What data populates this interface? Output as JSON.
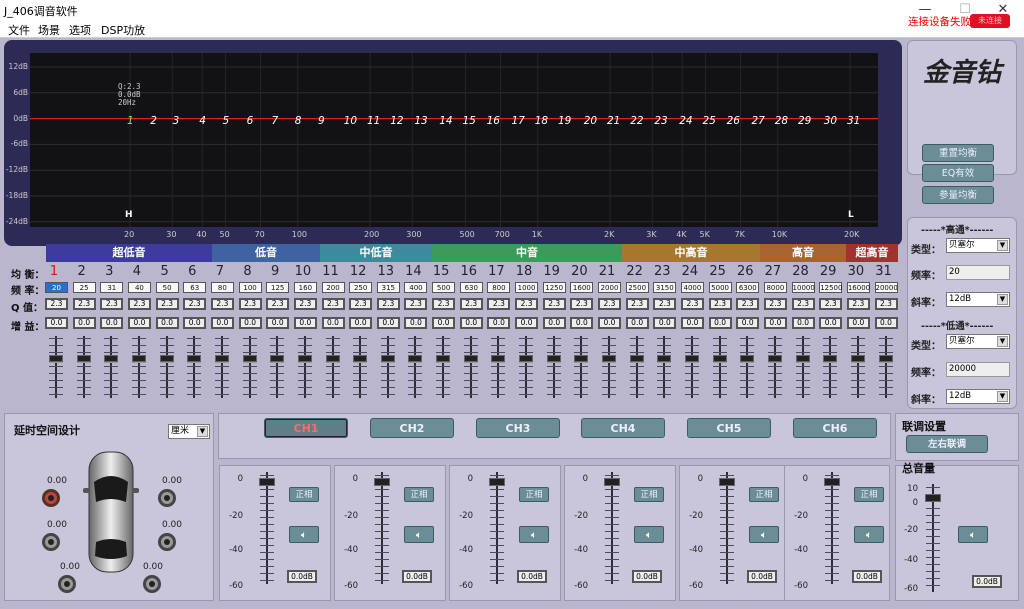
{
  "window": {
    "title": "J_406调音软件",
    "min": "—",
    "max": "☐",
    "close": "✕"
  },
  "menu": [
    "文件",
    "场景",
    "选项",
    "DSP功放"
  ],
  "graph": {
    "y_ticks": [
      "12dB",
      "6dB",
      "0dB",
      "-6dB",
      "-12dB",
      "-18dB",
      "-24dB"
    ],
    "x_ticks": [
      "20",
      "30",
      "40",
      "50",
      "70",
      "100",
      "200",
      "300",
      "500",
      "700",
      "1K",
      "2K",
      "3K",
      "4K",
      "5K",
      "7K",
      "10K",
      "20K"
    ],
    "tooltip": [
      "Q:2.3",
      "0.0dB",
      "20Hz"
    ],
    "marker_h": "H",
    "marker_l": "L",
    "points": [
      "1",
      "2",
      "3",
      "4",
      "5",
      "6",
      "7",
      "8",
      "9",
      "10",
      "11",
      "12",
      "13",
      "14",
      "15",
      "16",
      "17",
      "18",
      "19",
      "20",
      "21",
      "22",
      "23",
      "24",
      "25",
      "26",
      "27",
      "28",
      "29",
      "30",
      "31"
    ]
  },
  "bands": [
    {
      "label": "超低音",
      "color": "#3b3c9e"
    },
    {
      "label": "低音",
      "color": "#3f63a0"
    },
    {
      "label": "中低音",
      "color": "#3c8a9c"
    },
    {
      "label": "中音",
      "color": "#3b9b58"
    },
    {
      "label": "中高音",
      "color": "#a8772e"
    },
    {
      "label": "高音",
      "color": "#a8642e"
    },
    {
      "label": "超高音",
      "color": "#a53030"
    }
  ],
  "eq": {
    "row_labels": {
      "channel": "均 衡：",
      "freq": "频 率：",
      "q": "Q 值：",
      "gain": "增 益："
    },
    "channels": [
      "1",
      "2",
      "3",
      "4",
      "5",
      "6",
      "7",
      "8",
      "9",
      "10",
      "11",
      "12",
      "13",
      "14",
      "15",
      "16",
      "17",
      "18",
      "19",
      "20",
      "21",
      "22",
      "23",
      "24",
      "25",
      "26",
      "27",
      "28",
      "29",
      "30",
      "31"
    ],
    "freqs": [
      "20",
      "25",
      "31",
      "40",
      "50",
      "63",
      "80",
      "100",
      "125",
      "160",
      "200",
      "250",
      "315",
      "400",
      "500",
      "630",
      "800",
      "1000",
      "1250",
      "1600",
      "2000",
      "2500",
      "3150",
      "4000",
      "5000",
      "6300",
      "8000",
      "10000",
      "12500",
      "16000",
      "20000"
    ],
    "q": "2.3",
    "gain": "0.0"
  },
  "status": {
    "text": "连接设备失败",
    "button": "未连接"
  },
  "logo": "金音钻",
  "eq_buttons": [
    "重置均衡",
    "EQ有效",
    "参量均衡"
  ],
  "filters": {
    "high_header": "-----*高通*------",
    "low_header": "-----*低通*------",
    "type_label": "类型：",
    "freq_label": "频率：",
    "slope_label": "斜率：",
    "high": {
      "type": "贝塞尔",
      "freq": "20",
      "slope": "12dB"
    },
    "low": {
      "type": "贝塞尔",
      "freq": "20000",
      "slope": "12dB"
    }
  },
  "delay": {
    "title": "延时空间设计",
    "unit": "厘米",
    "values": [
      "0.00",
      "0.00",
      "0.00",
      "0.00",
      "0.00",
      "0.00"
    ]
  },
  "channels": [
    "CH1",
    "CH2",
    "CH3",
    "CH4",
    "CH5",
    "CH6"
  ],
  "channel_strip": {
    "ticks": [
      "0",
      "-20",
      "-40",
      "-60"
    ],
    "phase_button": "正相",
    "mute_icon": "speaker-icon",
    "db_value": "0.0dB"
  },
  "link": {
    "title": "联调设置",
    "button": "左右联调"
  },
  "master": {
    "title": "总音量",
    "ticks": [
      "10",
      "0",
      "-20",
      "-40",
      "-60"
    ],
    "db_value": "0.0dB"
  }
}
